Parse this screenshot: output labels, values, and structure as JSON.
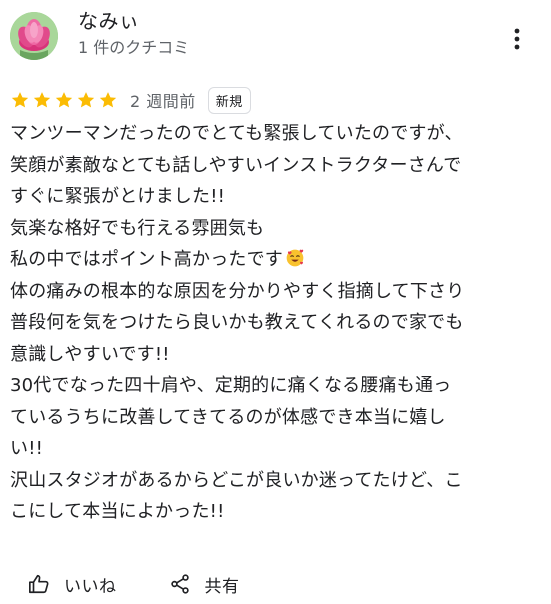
{
  "author": {
    "name": "なみぃ",
    "review_count": "1 件のクチコミ"
  },
  "icons": {
    "avatar": "pink-flower-avatar",
    "more": "more-vert-icon",
    "star": "star-icon",
    "emoji": "face-with-hearts-emoji",
    "like": "thumb-up-icon",
    "share": "share-icon"
  },
  "colors": {
    "star": "#FBBC04",
    "text": "#202124",
    "muted": "#5F6368"
  },
  "rating": {
    "stars": 5,
    "time_ago": "2 週間前",
    "badge": "新規"
  },
  "review": {
    "lines": [
      "マンツーマンだったのでとても緊張していたのですが、",
      "笑顔が素敵なとても話しやすいインストラクターさんで",
      "すぐに緊張がとけました!!",
      "気楽な格好でも行える雰囲気も",
      "私の中ではポイント高かったです",
      "体の痛みの根本的な原因を分かりやすく指摘して下さり",
      "普段何を気をつけたら良いかも教えてくれるので家でも",
      "意識しやすいです!!",
      "30代でなった四十肩や、定期的に痛くなる腰痛も通っ",
      "ているうちに改善してきてるのが体感でき本当に嬉し",
      "い!!",
      "沢山スタジオがあるからどこが良いか迷ってたけど、こ",
      "こにして本当によかった!!"
    ]
  },
  "actions": {
    "like_label": "いいね",
    "share_label": "共有"
  }
}
